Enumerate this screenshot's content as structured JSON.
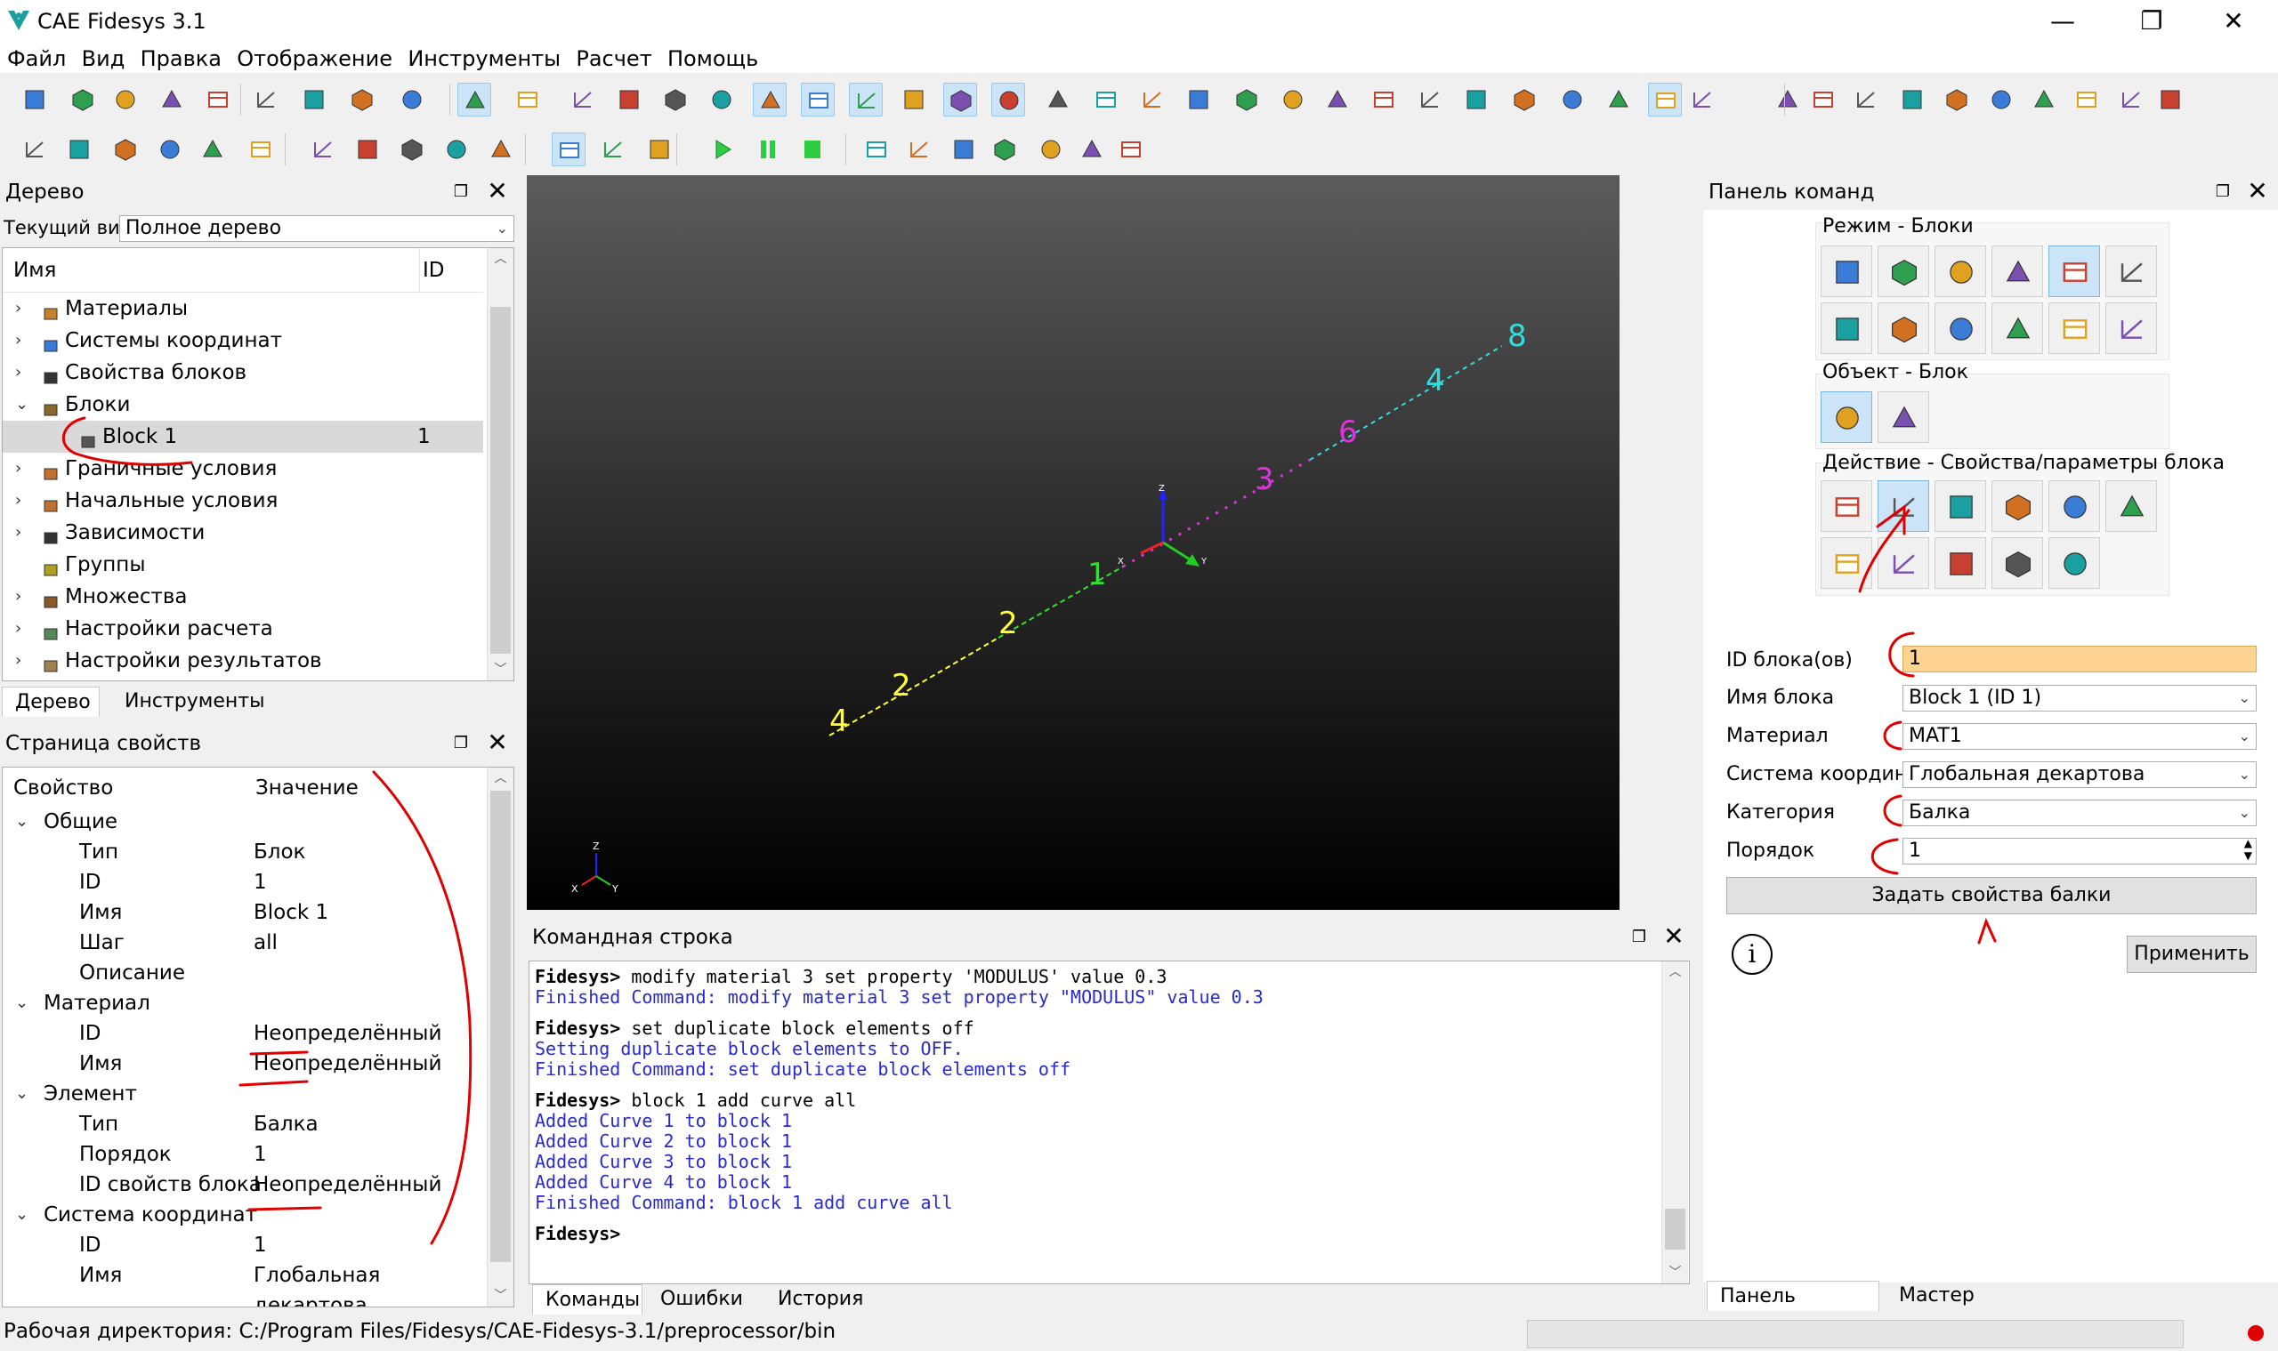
{
  "window": {
    "title": "CAE Fidesys 3.1",
    "minimize": "—",
    "maximize": "❐",
    "close": "✕"
  },
  "menu": [
    "Файл",
    "Вид",
    "Правка",
    "Отображение",
    "Инструменты",
    "Расчет",
    "Помощь"
  ],
  "tree_panel": {
    "title": "Дерево",
    "view_label": "Текущий вид",
    "view_value": "Полное дерево",
    "col_name": "Имя",
    "col_id": "ID",
    "items": [
      {
        "label": "Материалы",
        "expand": "›"
      },
      {
        "label": "Системы координат",
        "expand": "›"
      },
      {
        "label": "Свойства блоков",
        "expand": "›"
      },
      {
        "label": "Блоки",
        "expand": "⌄"
      },
      {
        "label": "Block 1",
        "id": "1"
      },
      {
        "label": "Граничные условия",
        "expand": "›"
      },
      {
        "label": "Начальные условия",
        "expand": "›"
      },
      {
        "label": "Зависимости",
        "expand": "›"
      },
      {
        "label": "Группы"
      },
      {
        "label": "Множества",
        "expand": "›"
      },
      {
        "label": "Настройки расчета",
        "expand": "›"
      },
      {
        "label": "Настройки результатов",
        "expand": "›"
      }
    ],
    "tabs": [
      "Дерево",
      "Инструменты"
    ]
  },
  "props_panel": {
    "title": "Страница свойств",
    "col_prop": "Свойство",
    "col_value": "Значение",
    "rows": [
      {
        "name": "Общие",
        "group": true
      },
      {
        "name": "Тип",
        "value": "Блок"
      },
      {
        "name": "ID",
        "value": "1"
      },
      {
        "name": "Имя",
        "value": "Block 1"
      },
      {
        "name": "Шаг",
        "value": "all"
      },
      {
        "name": "Описание",
        "value": ""
      },
      {
        "name": "Материал",
        "group": true
      },
      {
        "name": "ID",
        "value": "Неопределённый"
      },
      {
        "name": "Имя",
        "value": "Неопределённый"
      },
      {
        "name": "Элемент",
        "group": true
      },
      {
        "name": "Тип",
        "value": "Балка"
      },
      {
        "name": "Порядок",
        "value": "1"
      },
      {
        "name": "ID свойств блока",
        "value": "Неопределённый"
      },
      {
        "name": "Система координат",
        "group": true
      },
      {
        "name": "ID",
        "value": "1"
      },
      {
        "name": "Имя",
        "value": "Глобальная декартова"
      }
    ]
  },
  "viewport": {
    "labels": [
      {
        "text": "4",
        "color": "#ffff33"
      },
      {
        "text": "2",
        "color": "#ffff33"
      },
      {
        "text": "2",
        "color": "#ffff33"
      },
      {
        "text": "1",
        "color": "#33dd33"
      },
      {
        "text": "3",
        "color": "#dd33dd"
      },
      {
        "text": "6",
        "color": "#dd33dd"
      },
      {
        "text": "4",
        "color": "#33dddd"
      },
      {
        "text": "8",
        "color": "#33dddd"
      }
    ],
    "axis": {
      "x": "X",
      "y": "Y",
      "z": "Z"
    }
  },
  "console": {
    "title": "Командная строка",
    "lines": [
      {
        "kind": "cmd",
        "prompt": "Fidesys>",
        "text": " modify material 3 set property 'MODULUS' value 0.3"
      },
      {
        "kind": "out",
        "text": "Finished Command: modify material 3 set property \"MODULUS\" value 0.3"
      },
      {
        "kind": "cmd",
        "prompt": "Fidesys>",
        "text": " set duplicate block elements off"
      },
      {
        "kind": "out",
        "text": "Setting duplicate block elements to OFF."
      },
      {
        "kind": "out",
        "text": "Finished Command: set duplicate block elements off"
      },
      {
        "kind": "cmd",
        "prompt": "Fidesys>",
        "text": " block 1 add curve all"
      },
      {
        "kind": "out",
        "text": "Added Curve 1 to block 1"
      },
      {
        "kind": "out",
        "text": "Added Curve 2 to block 1"
      },
      {
        "kind": "out",
        "text": "Added Curve 3 to block 1"
      },
      {
        "kind": "out",
        "text": "Added Curve 4 to block 1"
      },
      {
        "kind": "out",
        "text": "Finished Command: block 1 add curve all"
      },
      {
        "kind": "cmd",
        "prompt": "Fidesys>",
        "text": ""
      }
    ],
    "tabs": [
      "Команды",
      "Ошибки",
      "История"
    ]
  },
  "command_panel": {
    "title": "Панель команд",
    "mode_label": "Режим - Блоки",
    "object_label": "Объект - Блок",
    "action_label": "Действие - Свойства/параметры блока",
    "form": {
      "block_ids_label": "ID блока(ов)",
      "block_ids_value": "1",
      "block_name_label": "Имя блока",
      "block_name_value": "Block 1 (ID 1)",
      "material_label": "Материал",
      "material_value": "MAT1",
      "cs_label": "Система координат",
      "cs_value": "Глобальная декартова",
      "category_label": "Категория",
      "category_value": "Балка",
      "order_label": "Порядок",
      "order_value": "1",
      "set_beam_button": "Задать свойства балки",
      "info_button": "i",
      "apply_button": "Применить"
    },
    "tabs": [
      "Панель команд",
      "Мастер"
    ]
  },
  "status": {
    "workdir": "Рабочая директория: C:/Program Files/Fidesys/CAE-Fidesys-3.1/preprocessor/bin"
  },
  "colors": {
    "accent": "#cce4f7",
    "highlight_field": "#ffd391",
    "annotation": "#e00000"
  }
}
